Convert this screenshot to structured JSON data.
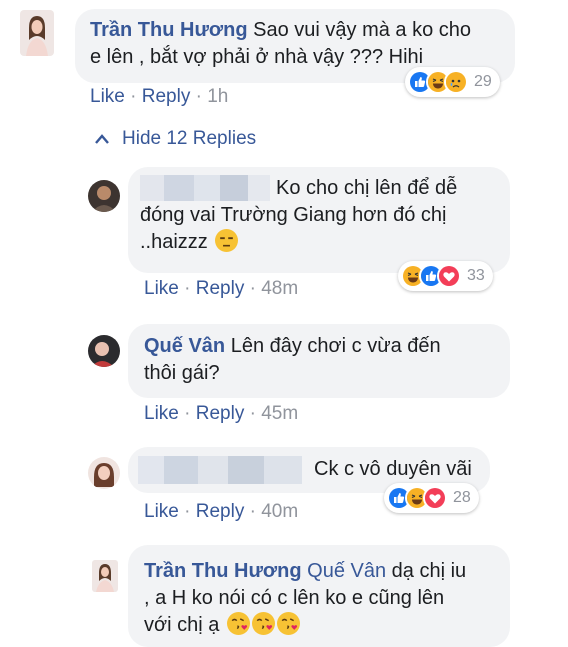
{
  "comment1": {
    "author": "Trần Thu Hương",
    "text_line1": "Sao vui vậy mà a ko cho",
    "text_line2": "e lên , bắt vợ phải ở nhà vậy ??? Hihi",
    "like": "Like",
    "reply": "Reply",
    "time": "1h",
    "reaction_count": "29"
  },
  "hide_replies": "Hide 12 Replies",
  "reply1": {
    "text_line1": "Ko cho chị lên để dễ",
    "text_line2": "đóng vai Trường Giang hơn đó chị",
    "text_line3": "..haizzz",
    "like": "Like",
    "reply": "Reply",
    "time": "48m",
    "reaction_count": "33"
  },
  "reply2": {
    "author": "Quế Vân",
    "text_line1": "Lên đây chơi c vừa đến",
    "text_line2": "thôi gái?",
    "like": "Like",
    "reply": "Reply",
    "time": "45m"
  },
  "reply3": {
    "text": "Ck c vô duyên vãi",
    "like": "Like",
    "reply": "Reply",
    "time": "40m",
    "reaction_count": "28"
  },
  "reply4": {
    "author": "Trần Thu Hương",
    "tag": "Quế Vân",
    "text_line1": "dạ chị iu",
    "text_line2": ", a H ko nói có c lên ko e cũng lên",
    "text_line3": "với chị ạ"
  },
  "separator": " · ",
  "colors": {
    "link": "#385898",
    "bubble": "#f2f3f5",
    "meta": "#90949c",
    "like_blue": "#1877f2",
    "love_red": "#f33e58",
    "haha_yellow": "#f7b125"
  }
}
